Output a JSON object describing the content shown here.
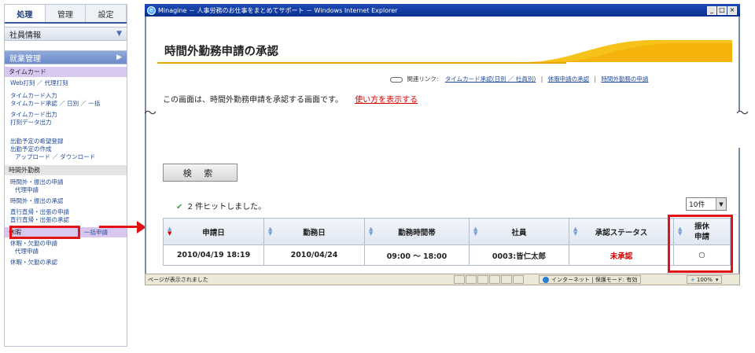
{
  "sidebar": {
    "tabs": [
      "処理",
      "管理",
      "設定"
    ],
    "employee_info": "社員情報",
    "work_mgmt": "就業管理",
    "timecard_cat": "タイムカード",
    "timecard_links": [
      "Web打刻 ／ 代理打刻",
      "タイムカード入力",
      "タイムカード承認 ／ 日別 ／ 一括",
      "タイムカード出力",
      "打刻データ出力"
    ],
    "plan_links": [
      "出勤予定の希望登録",
      "出勤予定の作成",
      "アップロード ／ ダウンロード"
    ],
    "overtime_cat": "時間外勤務",
    "overtime_links": [
      "時間外・振出の申請",
      "代理申請",
      "時間外・振出の承認",
      "直行直帰・出張の申請",
      "直行直帰・出張の承認"
    ],
    "ikkatsu": "一括申請",
    "leave_cat": "休暇",
    "leave_links": [
      "休暇・欠勤の申請",
      "代理申請",
      "休暇・欠勤の承認"
    ]
  },
  "window": {
    "title": "Minagine － 人事労務のお仕事をまとめてサポート － Windows Internet Explorer",
    "page_title": "時間外勤務申請の承認",
    "related_label": "関連リンク:",
    "related_links": [
      "タイムカード承認(日別 ／ 社員別)",
      "休暇申請の承認",
      "時間外勤務の申請"
    ],
    "description": "この画面は、時間外勤務申請を承認する画面です。",
    "howto": "使い方を表示する",
    "search_button": "検 索",
    "hits": "2 件ヒットしました。",
    "per_page": "10件",
    "columns": [
      "申請日",
      "勤務日",
      "勤務時間帯",
      "社員",
      "承認ステータス",
      "振休申請"
    ],
    "row": {
      "applied": "2010/04/19 18:19",
      "workday": "2010/04/24",
      "hours": "09:00 ～ 18:00",
      "employee": "0003:皆仁太郎",
      "status": "未承認",
      "transfer": "○"
    },
    "status_left": "ページが表示されました",
    "status_zone": "インターネット | 保護モード: 有効",
    "status_zoom": "100%"
  },
  "colors": {
    "accent": "#e01414",
    "link": "#1f4a9a",
    "status_unapproved": "#d40000"
  },
  "tilde": "～"
}
